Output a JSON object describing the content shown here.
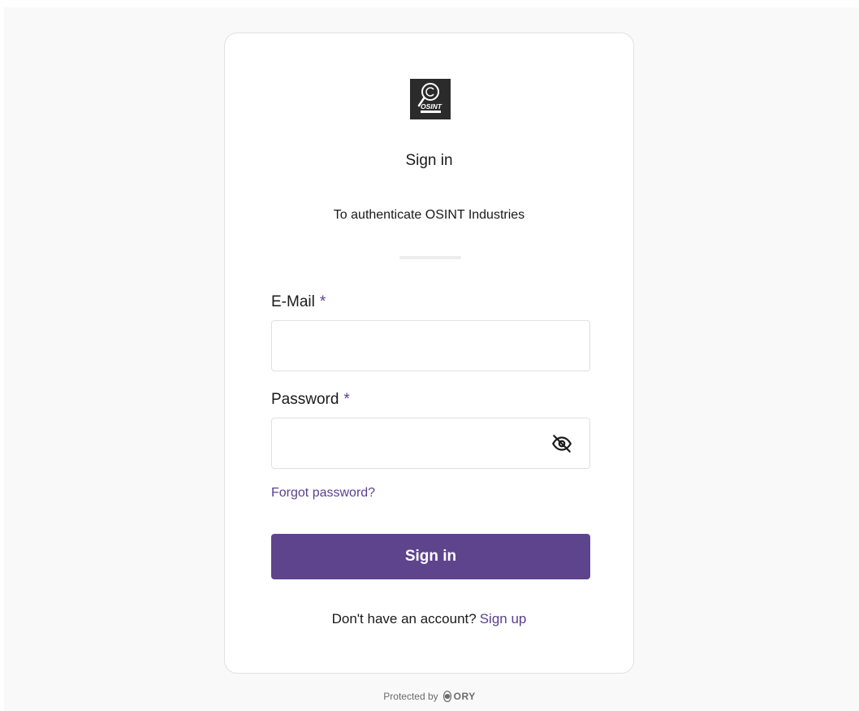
{
  "brand": {
    "logo_text": "OSINT",
    "icon": "osint-industries-logo",
    "accent_color": "#5e448d"
  },
  "header": {
    "title": "Sign in",
    "subtitle": "To authenticate OSINT Industries"
  },
  "form": {
    "email": {
      "label": "E-Mail",
      "required_marker": "*",
      "value": "",
      "placeholder": ""
    },
    "password": {
      "label": "Password",
      "required_marker": "*",
      "value": "",
      "placeholder": "",
      "toggle_icon": "eye-off-icon"
    },
    "forgot_password_label": "Forgot password?",
    "submit_label": "Sign in"
  },
  "signup": {
    "prompt": "Don't have an account?",
    "link_label": "Sign up"
  },
  "footer": {
    "protected_by": "Protected by",
    "provider": "ORY",
    "icon": "ory-logo-icon"
  }
}
